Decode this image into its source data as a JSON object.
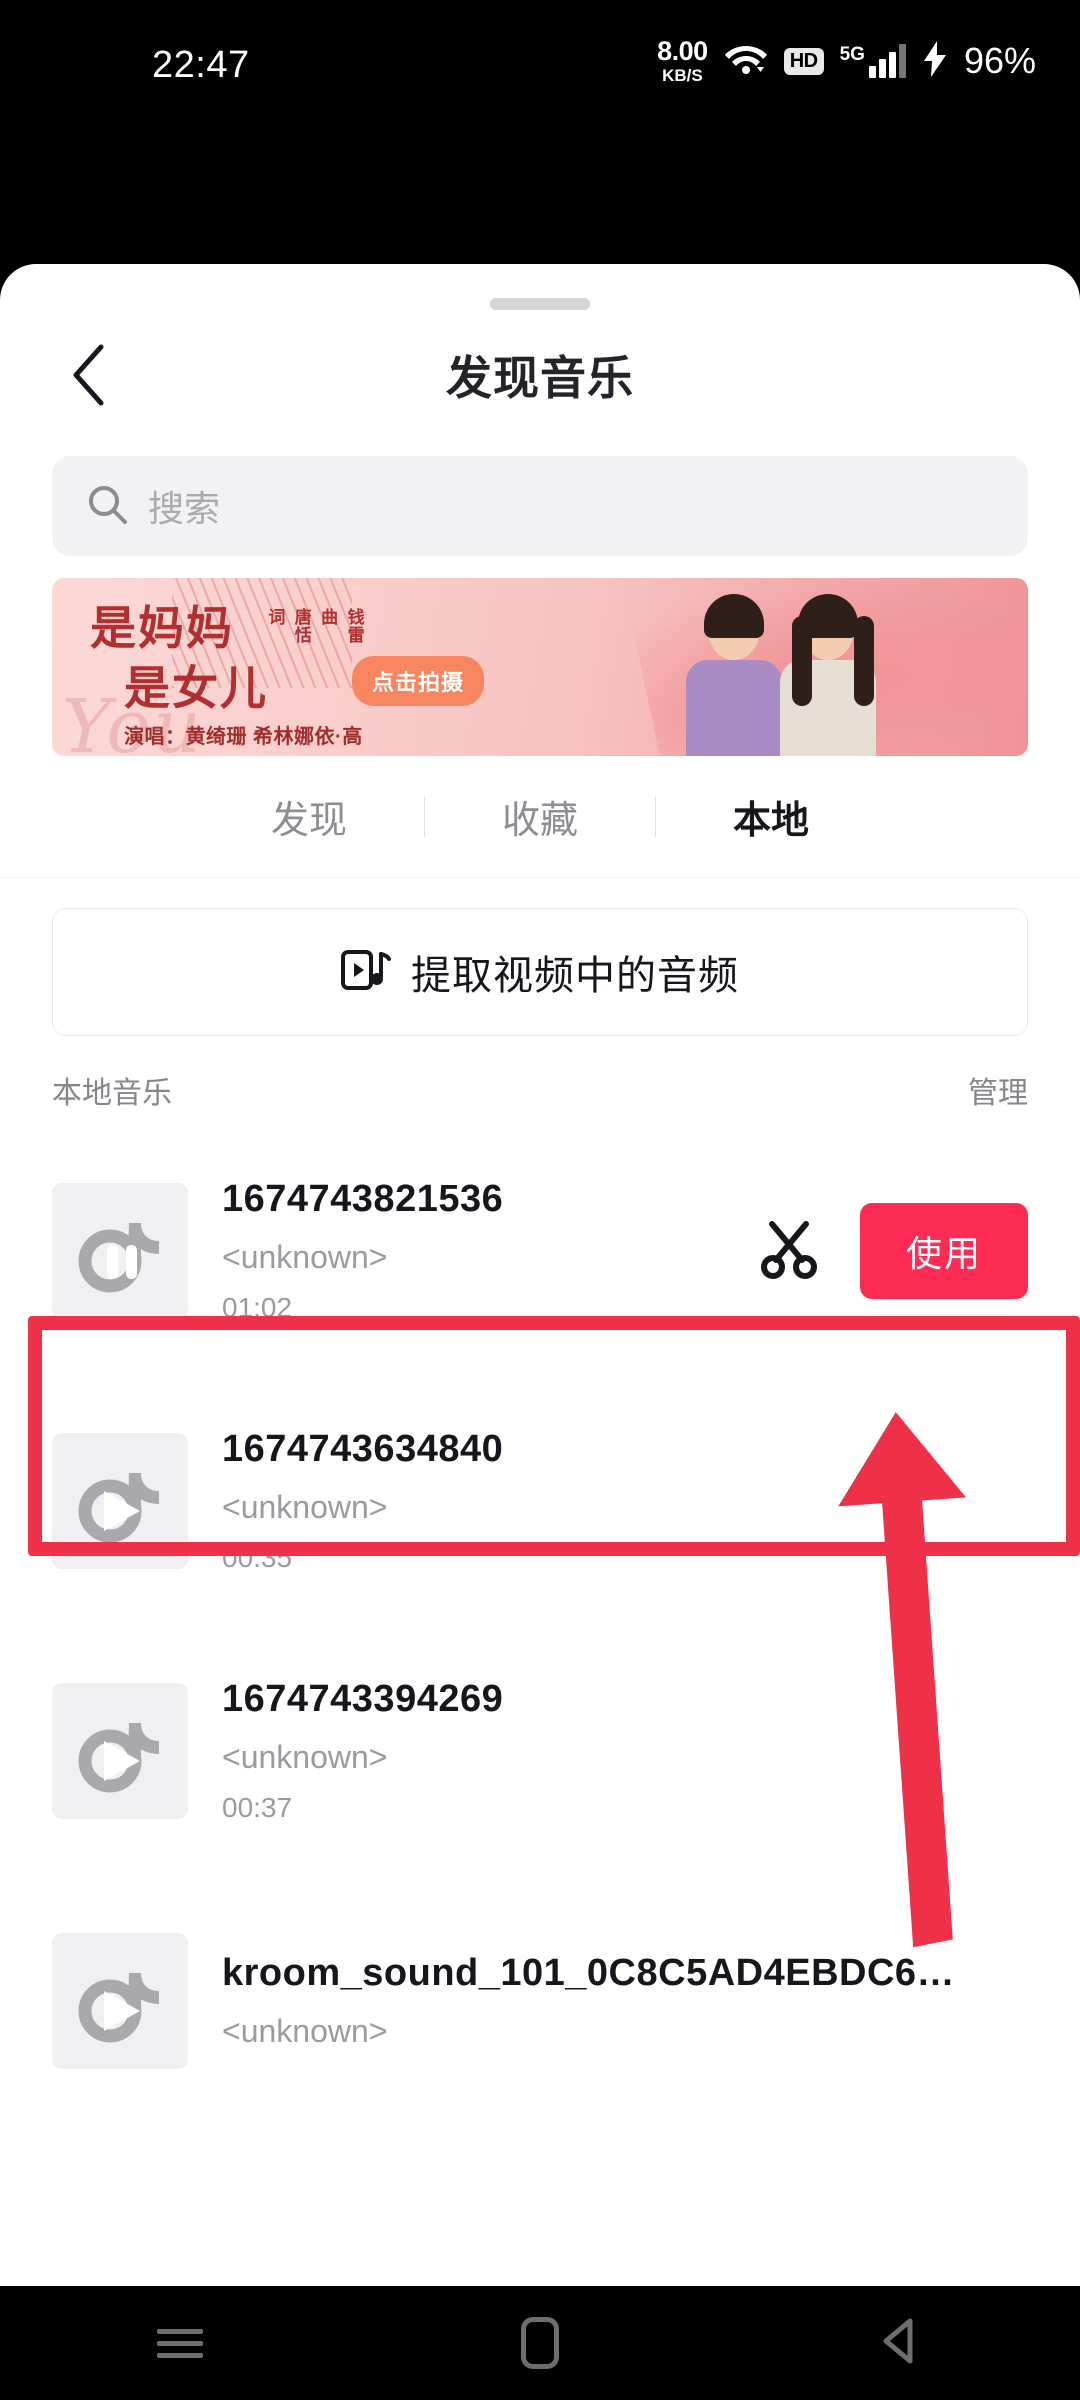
{
  "status_bar": {
    "time": "22:47",
    "net_speed_value": "8.00",
    "net_speed_unit": "KB/S",
    "wifi_icon": "wifi-icon",
    "hd_badge": "HD",
    "network_type": "5G",
    "charging_icon": "lightning-bolt-icon",
    "battery": "96%"
  },
  "header": {
    "back_icon": "chevron-left-icon",
    "title": "发现音乐",
    "grabber": "sheet-drag-handle"
  },
  "search": {
    "icon": "search-icon",
    "placeholder": "搜索",
    "value": ""
  },
  "banner": {
    "title_line1": "是妈妈",
    "title_line2": "是女儿",
    "credit_label_1": "词",
    "credit_name_1": "唐恬",
    "credit_label_2": "曲",
    "credit_name_2": "钱雷",
    "cta_label": "点击拍摄",
    "singer_line": "演唱：黄绮珊 希林娜依·高",
    "script_text": "You",
    "accent_color": "#b1302f",
    "cta_color": "#f7855f"
  },
  "tabs": [
    {
      "label": "发现",
      "active": false
    },
    {
      "label": "收藏",
      "active": false
    },
    {
      "label": "本地",
      "active": true
    }
  ],
  "extract": {
    "icon": "video-music-extract-icon",
    "label": "提取视频中的音频"
  },
  "section": {
    "title": "本地音乐",
    "manage_label": "管理"
  },
  "tracks": [
    {
      "name": "1674743821536",
      "artist": "<unknown>",
      "duration": "01:02",
      "thumb_icon": "music-note-pause-icon",
      "playing": true,
      "cut_icon": "scissors-icon",
      "use_label": "使用",
      "highlighted": true
    },
    {
      "name": "1674743634840",
      "artist": "<unknown>",
      "duration": "00:35",
      "thumb_icon": "music-note-play-icon",
      "playing": false,
      "cut_icon": "",
      "use_label": "",
      "highlighted": false
    },
    {
      "name": "1674743394269",
      "artist": "<unknown>",
      "duration": "00:37",
      "thumb_icon": "music-note-play-icon",
      "playing": false,
      "cut_icon": "",
      "use_label": "",
      "highlighted": false
    },
    {
      "name": "kroom_sound_101_0C8C5AD4EBDC6…",
      "artist": "<unknown>",
      "duration": "",
      "thumb_icon": "music-note-play-icon",
      "playing": false,
      "cut_icon": "",
      "use_label": "",
      "highlighted": false
    }
  ],
  "annotation": {
    "highlight_color": "#ee3049",
    "arrow_icon": "up-arrow-annotation",
    "target": "使用"
  },
  "nav_bar": {
    "recents_icon": "recents-lines-icon",
    "home_icon": "home-square-icon",
    "back_icon": "back-triangle-icon"
  },
  "theme": {
    "brand_red": "#fe2c55",
    "text_primary": "#16171c",
    "text_muted": "#9a9aa0",
    "surface": "#ffffff",
    "field_bg": "#f2f2f4"
  }
}
